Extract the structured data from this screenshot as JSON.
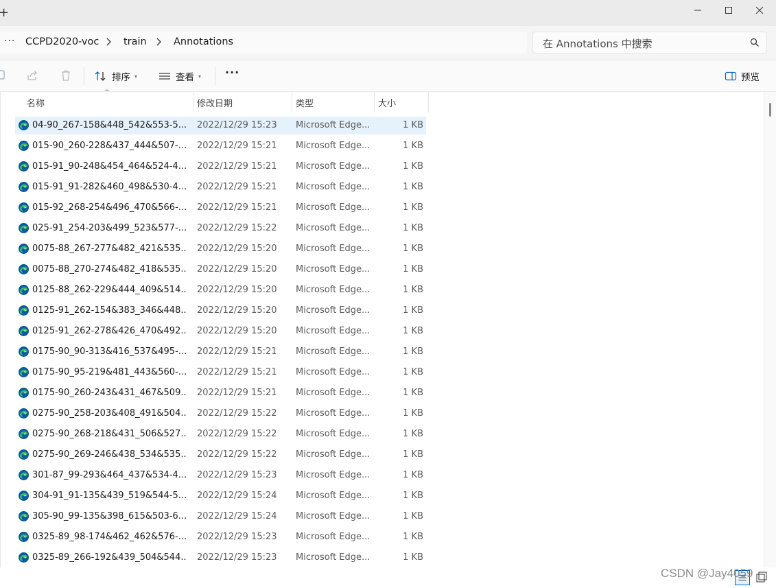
{
  "window": {
    "new_tab_glyph": "+",
    "minimize_glyph": "—",
    "maximize_glyph": "☐",
    "close_glyph": "✕"
  },
  "breadcrumb": {
    "overflow": "···",
    "items": [
      "CCPD2020-voc",
      "train",
      "Annotations"
    ]
  },
  "search": {
    "placeholder": "在 Annotations 中搜索"
  },
  "toolbar": {
    "sort_label": "排序",
    "view_label": "查看",
    "more_label": "···",
    "preview_label": "预览"
  },
  "columns": {
    "name": "名称",
    "date": "修改日期",
    "type": "类型",
    "size": "大小"
  },
  "files": [
    {
      "name": "04-90_267-158&448_542&553-5...",
      "date": "2022/12/29 15:23",
      "type": "Microsoft Edge...",
      "size": "1 KB"
    },
    {
      "name": "015-90_260-228&437_444&507-...",
      "date": "2022/12/29 15:21",
      "type": "Microsoft Edge...",
      "size": "1 KB"
    },
    {
      "name": "015-91_90-248&454_464&524-4...",
      "date": "2022/12/29 15:21",
      "type": "Microsoft Edge...",
      "size": "1 KB"
    },
    {
      "name": "015-91_91-282&460_498&530-4...",
      "date": "2022/12/29 15:21",
      "type": "Microsoft Edge...",
      "size": "1 KB"
    },
    {
      "name": "015-92_268-254&496_470&566-...",
      "date": "2022/12/29 15:21",
      "type": "Microsoft Edge...",
      "size": "1 KB"
    },
    {
      "name": "025-91_254-203&499_523&577-...",
      "date": "2022/12/29 15:22",
      "type": "Microsoft Edge...",
      "size": "1 KB"
    },
    {
      "name": "0075-88_267-277&482_421&535...",
      "date": "2022/12/29 15:20",
      "type": "Microsoft Edge...",
      "size": "1 KB"
    },
    {
      "name": "0075-88_270-274&482_418&535...",
      "date": "2022/12/29 15:20",
      "type": "Microsoft Edge...",
      "size": "1 KB"
    },
    {
      "name": "0125-88_262-229&444_409&514...",
      "date": "2022/12/29 15:20",
      "type": "Microsoft Edge...",
      "size": "1 KB"
    },
    {
      "name": "0125-91_262-154&383_346&448...",
      "date": "2022/12/29 15:20",
      "type": "Microsoft Edge...",
      "size": "1 KB"
    },
    {
      "name": "0125-91_262-278&426_470&492...",
      "date": "2022/12/29 15:20",
      "type": "Microsoft Edge...",
      "size": "1 KB"
    },
    {
      "name": "0175-90_90-313&416_537&495-...",
      "date": "2022/12/29 15:21",
      "type": "Microsoft Edge...",
      "size": "1 KB"
    },
    {
      "name": "0175-90_95-219&481_443&560-...",
      "date": "2022/12/29 15:21",
      "type": "Microsoft Edge...",
      "size": "1 KB"
    },
    {
      "name": "0175-90_260-243&431_467&509...",
      "date": "2022/12/29 15:21",
      "type": "Microsoft Edge...",
      "size": "1 KB"
    },
    {
      "name": "0275-90_258-203&408_491&504...",
      "date": "2022/12/29 15:22",
      "type": "Microsoft Edge...",
      "size": "1 KB"
    },
    {
      "name": "0275-90_268-218&431_506&527...",
      "date": "2022/12/29 15:22",
      "type": "Microsoft Edge...",
      "size": "1 KB"
    },
    {
      "name": "0275-90_269-246&438_534&535...",
      "date": "2022/12/29 15:22",
      "type": "Microsoft Edge...",
      "size": "1 KB"
    },
    {
      "name": "301-87_99-293&464_437&534-4...",
      "date": "2022/12/29 15:23",
      "type": "Microsoft Edge...",
      "size": "1 KB"
    },
    {
      "name": "304-91_91-135&439_519&544-5...",
      "date": "2022/12/29 15:24",
      "type": "Microsoft Edge...",
      "size": "1 KB"
    },
    {
      "name": "305-90_99-135&398_615&503-6...",
      "date": "2022/12/29 15:24",
      "type": "Microsoft Edge...",
      "size": "1 KB"
    },
    {
      "name": "0325-89_98-174&462_462&576-...",
      "date": "2022/12/29 15:23",
      "type": "Microsoft Edge...",
      "size": "1 KB"
    },
    {
      "name": "0325-89_266-192&439_504&544...",
      "date": "2022/12/29 15:23",
      "type": "Microsoft Edge...",
      "size": "1 KB"
    }
  ],
  "selected_index": 0,
  "watermark": "CSDN @Jay4059",
  "colors": {
    "selection": "#e5f1fb",
    "accent": "#0067c0",
    "edge_blue": "#0c59a4",
    "edge_green": "#3bbf57"
  }
}
